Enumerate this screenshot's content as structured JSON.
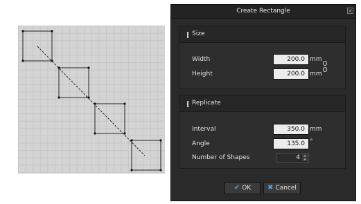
{
  "dialog": {
    "title": "Create Rectangle",
    "size_panel": {
      "title": "Size",
      "width_label": "Width",
      "width_value": "200.0",
      "width_unit": "mm",
      "height_label": "Height",
      "height_value": "200.0",
      "height_unit": "mm",
      "link_icon": "chain-link-icon"
    },
    "replicate_panel": {
      "title": "Replicate",
      "interval_label": "Interval",
      "interval_value": "350.0",
      "interval_unit": "mm",
      "angle_label": "Angle",
      "angle_value": "135.0",
      "angle_unit": "°",
      "count_label": "Number of Shapes",
      "count_value": "4"
    },
    "buttons": {
      "ok_label": "OK",
      "cancel_label": "Cancel"
    }
  },
  "preview": {
    "shape_count": 4,
    "colors": {
      "canvas": "#d4d4d4",
      "grid": "#c6c6c6",
      "stroke": "#222222"
    }
  },
  "colors": {
    "dialog_bg": "#2a2a2a",
    "panel_bg": "#2e2e2e",
    "field_bg": "#ececec",
    "ok_check": "#4aa3e8",
    "cancel_x": "#4aa3e8"
  }
}
